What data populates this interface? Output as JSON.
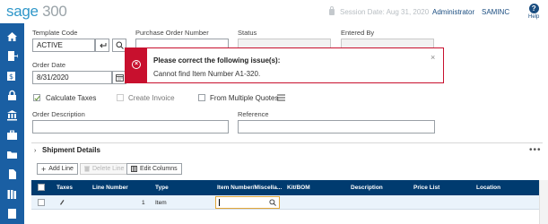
{
  "header": {
    "logo_brand": "sage",
    "logo_number": "300",
    "session_date": "Session Date:  Aug 31, 2020",
    "user": "Administrator",
    "company": "SAMINC",
    "help_label": "Help"
  },
  "sidebar": {
    "icons": [
      "home-icon",
      "document-arrow-icon",
      "dollar-icon",
      "lock-icon",
      "bank-icon",
      "briefcase-icon",
      "folder-icon",
      "file-icon",
      "books-icon",
      "list-icon"
    ]
  },
  "form": {
    "template_code": {
      "label": "Template Code",
      "value": "ACTIVE"
    },
    "purchase_order_number": {
      "label": "Purchase Order Number",
      "value": ""
    },
    "status": {
      "label": "Status",
      "value": ""
    },
    "entered_by": {
      "label": "Entered By",
      "value": ""
    },
    "order_date": {
      "label": "Order Date",
      "value": "8/31/2020"
    },
    "calculate_taxes": {
      "label": "Calculate Taxes",
      "checked": true
    },
    "create_invoice": {
      "label": "Create Invoice",
      "checked": false
    },
    "from_multiple_quotes": {
      "label": "From Multiple Quotes",
      "checked": false
    },
    "order_description": {
      "label": "Order Description",
      "value": ""
    },
    "reference": {
      "label": "Reference",
      "value": ""
    }
  },
  "error": {
    "title": "Please correct the following issue(s):",
    "message": "Cannot find Item Number A1-320."
  },
  "shipment": {
    "title": "Shipment Details",
    "add_line": "Add Line",
    "delete_line": "Delete Line",
    "edit_columns": "Edit Columns",
    "columns": [
      "Taxes",
      "Line Number",
      "Type",
      "Item Number/Miscella...",
      "Kit/BOM",
      "Description",
      "Price List",
      "Location"
    ],
    "rows": [
      {
        "line_number": "1",
        "type": "Item",
        "item_number": ""
      }
    ]
  },
  "colors": {
    "brand": "#2f97c9",
    "sidebar": "#1a5fa3",
    "grid_header": "#003b6f",
    "error": "#c8102e",
    "focus": "#e2a73a"
  }
}
